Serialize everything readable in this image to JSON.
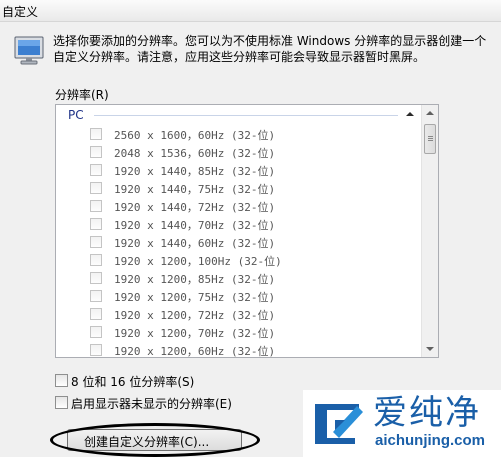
{
  "window": {
    "title": "自定义"
  },
  "description": "选择你要添加的分辨率。您可以为不使用标准 Windows 分辨率的显示器创建一个自定义分辨率。请注意，应用这些分辨率可能会导致显示器暂时黑屏。",
  "list": {
    "label": "分辨率(R)",
    "group": "PC",
    "items": [
      "2560 x 1600，60Hz (32-位)",
      "2048 x 1536，60Hz (32-位)",
      "1920 x 1440，85Hz (32-位)",
      "1920 x 1440，75Hz (32-位)",
      "1920 x 1440，72Hz (32-位)",
      "1920 x 1440，70Hz (32-位)",
      "1920 x 1440，60Hz (32-位)",
      "1920 x 1200，100Hz (32-位)",
      "1920 x 1200，85Hz (32-位)",
      "1920 x 1200，75Hz (32-位)",
      "1920 x 1200，72Hz (32-位)",
      "1920 x 1200，70Hz (32-位)",
      "1920 x 1200，60Hz (32-位)"
    ]
  },
  "options": {
    "bit_depth": "8 位和 16 位分辨率(S)",
    "unsupported": "启用显示器未显示的分辨率(E)"
  },
  "create_button": "创建自定义分辨率(C)...",
  "watermark": {
    "brand": "爱纯净",
    "url": "aichunjing.com"
  }
}
